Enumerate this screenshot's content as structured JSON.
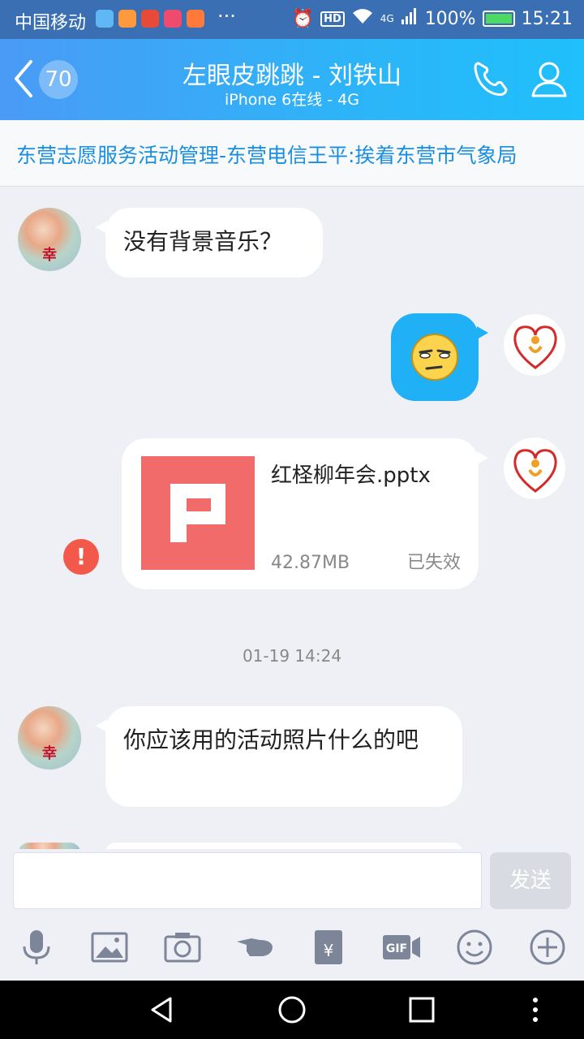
{
  "status_bar": {
    "carrier": "中国移动",
    "more": "···",
    "network": "4G",
    "battery": "100%",
    "time": "15:21",
    "hd": "HD"
  },
  "header": {
    "unread_count": "70",
    "title": "左眼皮跳跳 - 刘铁山",
    "subtitle": "iPhone 6在线 - 4G"
  },
  "notice": {
    "text": "东营志愿服务活动管理-东营电信王平:挨着东营市气象局"
  },
  "messages": {
    "m1": {
      "text": "没有背景音乐？"
    },
    "m3": {
      "file_name": "红柽柳年会.pptx",
      "file_size": "42.87MB",
      "status": "已失效",
      "file_icon_letter": "P",
      "error_mark": "!"
    },
    "timestamp": "01-19 14:24",
    "m4": {
      "text": "你应该用的活动照片什么的吧"
    }
  },
  "input": {
    "send_label": "发送",
    "placeholder": ""
  },
  "colors": {
    "header_start": "#4a9bf5",
    "header_end": "#1fc0fb",
    "accent": "#1fb0f6",
    "file_icon": "#f26b6b",
    "error": "#f2594b",
    "notice_text": "#1a8fe0"
  },
  "icons": {
    "toolbar": [
      "microphone-icon",
      "image-icon",
      "camera-icon",
      "poke-icon",
      "red-packet-icon",
      "gif-icon",
      "emoji-icon",
      "plus-icon"
    ],
    "nav": [
      "back-triangle-icon",
      "home-circle-icon",
      "recent-square-icon",
      "menu-dots-icon"
    ]
  }
}
